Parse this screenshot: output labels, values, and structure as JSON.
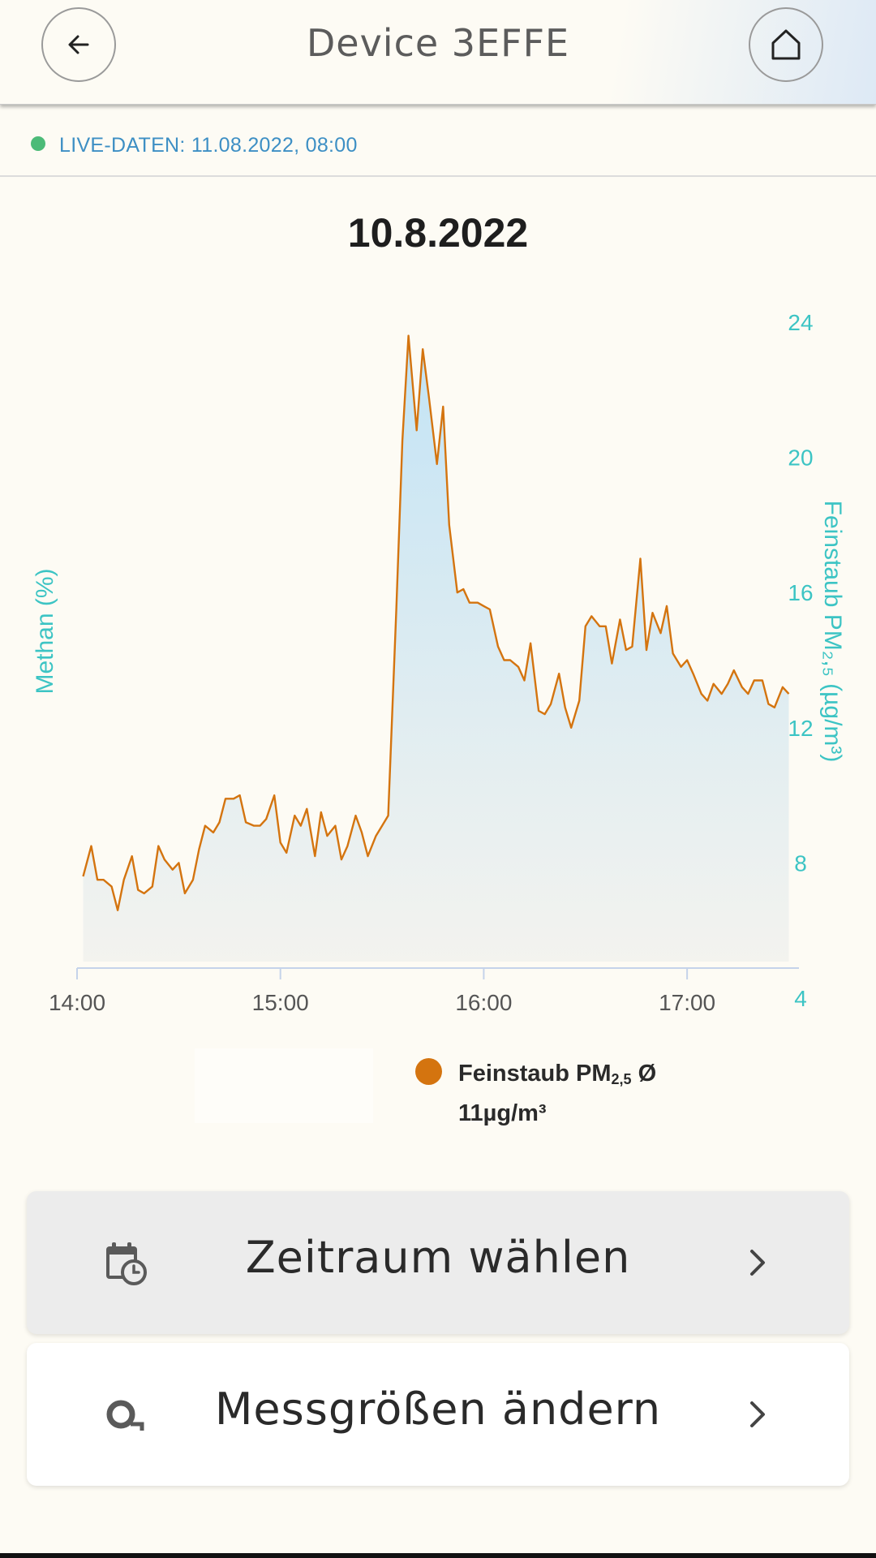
{
  "header": {
    "title": "Device 3EFFE",
    "back_icon": "arrow-left-icon",
    "home_icon": "home-icon"
  },
  "live": {
    "text": "LIVE-DATEN: 11.08.2022, 08:00",
    "status_color": "#4cbb78"
  },
  "chart_data": {
    "type": "area",
    "title": "10.8.2022",
    "y_left_label": "Methan (%)",
    "y_right_label": "Feinstaub PM₂,₅ (µg/m³)",
    "x_ticks": [
      "14:00",
      "15:00",
      "16:00",
      "17:00"
    ],
    "y_right_ticks": [
      4,
      8,
      12,
      16,
      20,
      24
    ],
    "ylim": [
      4,
      24
    ],
    "x_range_hours": [
      14.0,
      17.55
    ],
    "line_color": "#d4740f",
    "accent_color": "#3cc4c4",
    "series": [
      {
        "name": "Feinstaub PM₂,₅",
        "x": [
          14.03,
          14.07,
          14.1,
          14.13,
          14.17,
          14.2,
          14.23,
          14.27,
          14.3,
          14.33,
          14.37,
          14.4,
          14.43,
          14.47,
          14.5,
          14.53,
          14.57,
          14.6,
          14.63,
          14.67,
          14.7,
          14.73,
          14.77,
          14.8,
          14.83,
          14.87,
          14.9,
          14.93,
          14.97,
          15.0,
          15.03,
          15.07,
          15.1,
          15.13,
          15.17,
          15.2,
          15.23,
          15.27,
          15.3,
          15.33,
          15.37,
          15.4,
          15.43,
          15.47,
          15.5,
          15.53,
          15.57,
          15.6,
          15.63,
          15.67,
          15.7,
          15.73,
          15.77,
          15.8,
          15.83,
          15.87,
          15.9,
          15.93,
          15.97,
          16.0,
          16.03,
          16.07,
          16.1,
          16.13,
          16.17,
          16.2,
          16.23,
          16.27,
          16.3,
          16.33,
          16.37,
          16.4,
          16.43,
          16.47,
          16.5,
          16.53,
          16.57,
          16.6,
          16.63,
          16.67,
          16.7,
          16.73,
          16.77,
          16.8,
          16.83,
          16.87,
          16.9,
          16.93,
          16.97,
          17.0,
          17.03,
          17.07,
          17.1,
          17.13,
          17.17,
          17.2,
          17.23,
          17.27,
          17.3,
          17.33,
          17.37,
          17.4,
          17.43,
          17.47,
          17.5
        ],
        "values": [
          7.6,
          8.5,
          7.5,
          7.5,
          7.3,
          6.6,
          7.5,
          8.2,
          7.2,
          7.1,
          7.3,
          8.5,
          8.1,
          7.8,
          8.0,
          7.1,
          7.5,
          8.4,
          9.1,
          8.9,
          9.2,
          9.9,
          9.9,
          10.0,
          9.2,
          9.1,
          9.1,
          9.3,
          10.0,
          8.6,
          8.3,
          9.4,
          9.1,
          9.6,
          8.2,
          9.5,
          8.8,
          9.1,
          8.1,
          8.5,
          9.4,
          8.9,
          8.2,
          8.8,
          9.1,
          9.4,
          15.5,
          20.5,
          23.6,
          20.8,
          23.2,
          21.8,
          19.8,
          21.5,
          18.0,
          16.0,
          16.1,
          15.7,
          15.7,
          15.6,
          15.5,
          14.4,
          14.0,
          14.0,
          13.8,
          13.4,
          14.5,
          12.5,
          12.4,
          12.7,
          13.6,
          12.6,
          12.0,
          12.8,
          15.0,
          15.3,
          15.0,
          15.0,
          13.9,
          15.2,
          14.3,
          14.4,
          17.0,
          14.3,
          15.4,
          14.8,
          15.6,
          14.2,
          13.8,
          14.0,
          13.6,
          13.0,
          12.8,
          13.3,
          13.0,
          13.3,
          13.7,
          13.2,
          13.0,
          13.4,
          13.4,
          12.7,
          12.6,
          13.2,
          13.0
        ]
      }
    ],
    "legend": {
      "label_main": "Feinstaub PM",
      "label_sub": "2,5",
      "label_suffix": " Ø",
      "value_line": "11µg/m³"
    },
    "grid": false
  },
  "actions": [
    {
      "label": "Zeitraum wählen",
      "icon": "calendar-clock-icon",
      "chevron": "chevron-right-icon"
    },
    {
      "label": "Messgrößen ändern",
      "icon": "sensor-icon",
      "chevron": "chevron-right-icon"
    }
  ]
}
